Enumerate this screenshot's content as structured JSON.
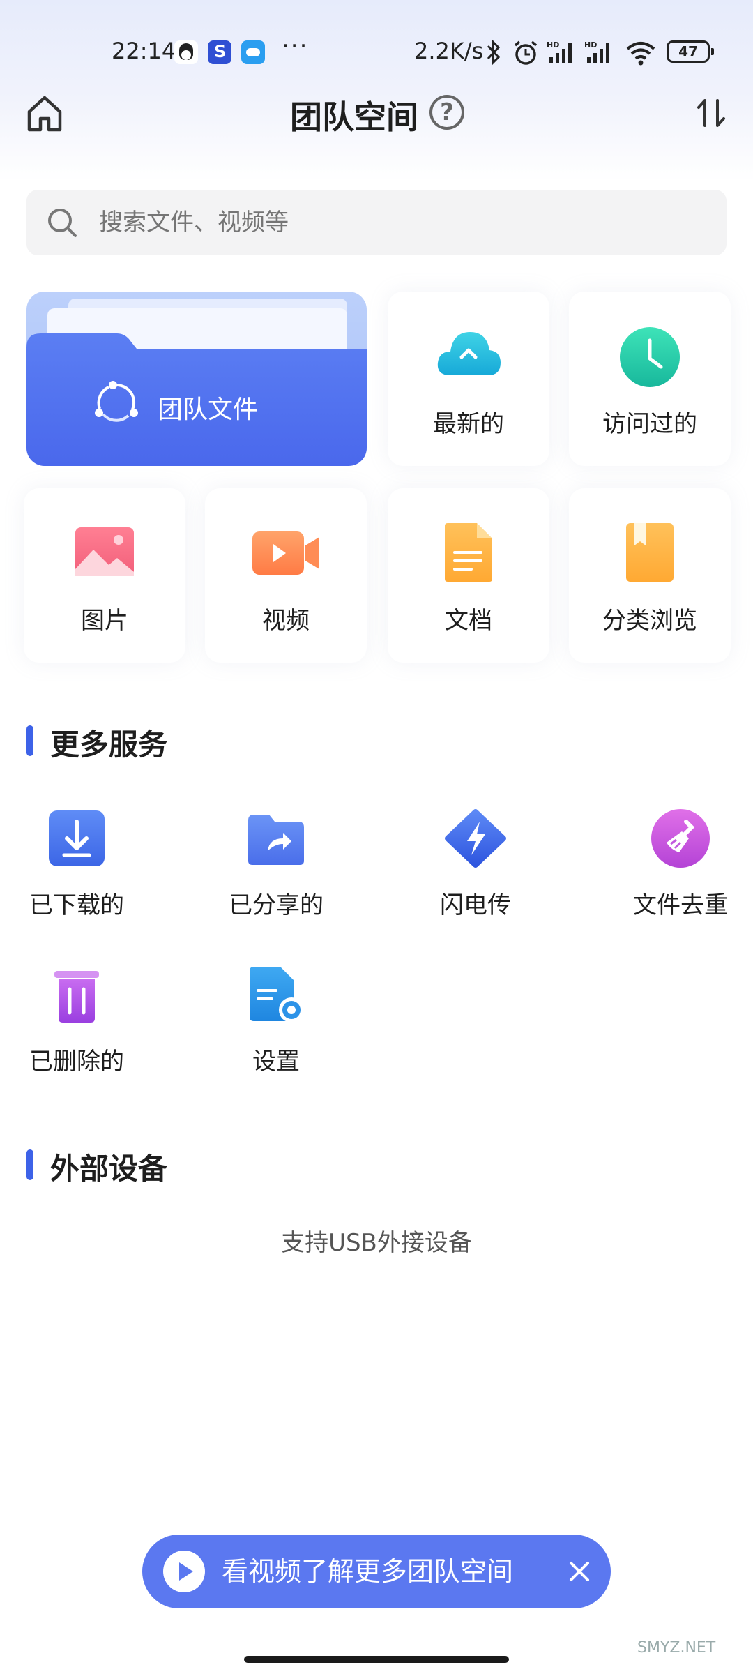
{
  "status_bar": {
    "time": "22:14",
    "net_speed": "2.2K/s",
    "battery": "47",
    "more": "···",
    "icons": [
      "qq-icon",
      "app-s-icon",
      "cloud-app-icon",
      "bluetooth-icon",
      "alarm-icon",
      "hd-signal-icon",
      "hd-signal-icon",
      "wifi-icon",
      "battery-icon"
    ]
  },
  "header": {
    "title": "团队空间",
    "help_symbol": "?"
  },
  "search": {
    "placeholder": "搜索文件、视频等"
  },
  "quick": {
    "team_files": "团队文件",
    "recent": "最新的",
    "visited": "访问过的"
  },
  "categories": {
    "images": "图片",
    "videos": "视频",
    "docs": "文档",
    "browse": "分类浏览"
  },
  "more_services": {
    "title": "更多服务",
    "items": [
      {
        "label": "已下载的",
        "icon": "download-icon"
      },
      {
        "label": "已分享的",
        "icon": "share-folder-icon"
      },
      {
        "label": "闪电传",
        "icon": "lightning-transfer-icon"
      },
      {
        "label": "文件去重",
        "icon": "dedupe-broom-icon"
      },
      {
        "label": "已删除的",
        "icon": "trash-icon"
      },
      {
        "label": "设置",
        "icon": "settings-doc-icon"
      }
    ]
  },
  "external_devices": {
    "title": "外部设备",
    "note": "支持USB外接设备"
  },
  "banner": {
    "text": "看视频了解更多团队空间"
  },
  "watermark": "SMYZ.NET",
  "colors": {
    "accent": "#3d62e8",
    "banner": "#5b78f0"
  }
}
